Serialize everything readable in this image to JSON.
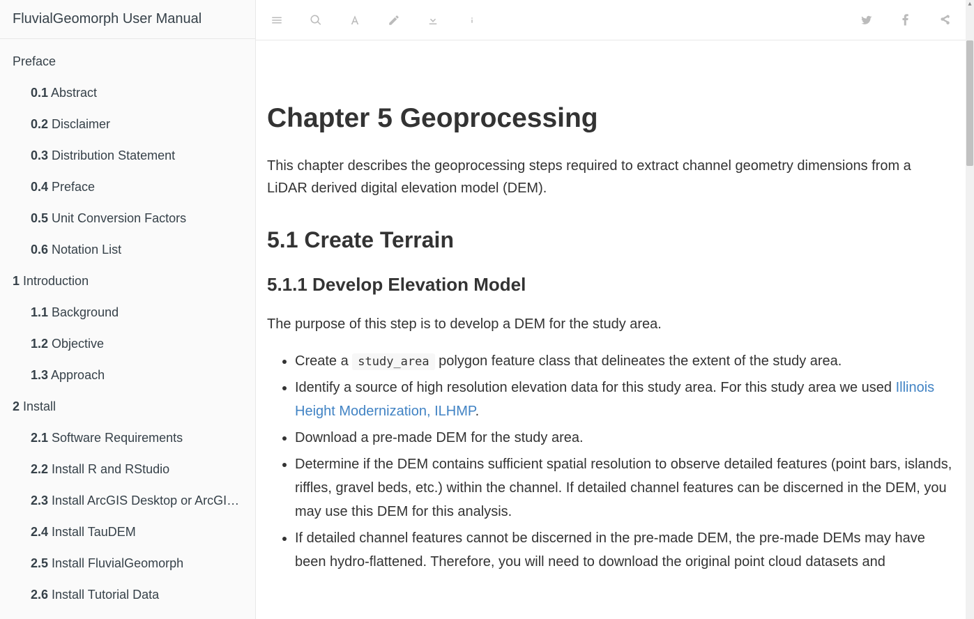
{
  "sidebar": {
    "title": "FluvialGeomorph User Manual",
    "items": [
      {
        "level": 1,
        "num": "",
        "label": "Preface"
      },
      {
        "level": 2,
        "num": "0.1",
        "label": "Abstract"
      },
      {
        "level": 2,
        "num": "0.2",
        "label": "Disclaimer"
      },
      {
        "level": 2,
        "num": "0.3",
        "label": "Distribution Statement"
      },
      {
        "level": 2,
        "num": "0.4",
        "label": "Preface"
      },
      {
        "level": 2,
        "num": "0.5",
        "label": "Unit Conversion Factors"
      },
      {
        "level": 2,
        "num": "0.6",
        "label": "Notation List"
      },
      {
        "level": 1,
        "num": "1",
        "label": "Introduction"
      },
      {
        "level": 2,
        "num": "1.1",
        "label": "Background"
      },
      {
        "level": 2,
        "num": "1.2",
        "label": "Objective"
      },
      {
        "level": 2,
        "num": "1.3",
        "label": "Approach"
      },
      {
        "level": 1,
        "num": "2",
        "label": "Install"
      },
      {
        "level": 2,
        "num": "2.1",
        "label": "Software Requirements"
      },
      {
        "level": 2,
        "num": "2.2",
        "label": "Install R and RStudio"
      },
      {
        "level": 2,
        "num": "2.3",
        "label": "Install ArcGIS Desktop or ArcGIS Pro"
      },
      {
        "level": 2,
        "num": "2.4",
        "label": "Install TauDEM"
      },
      {
        "level": 2,
        "num": "2.5",
        "label": "Install FluvialGeomorph"
      },
      {
        "level": 2,
        "num": "2.6",
        "label": "Install Tutorial Data"
      }
    ]
  },
  "content": {
    "h1": "Chapter 5   Geoprocessing",
    "p1": "This chapter describes the geoprocessing steps required to extract channel geometry dimensions from a LiDAR derived digital elevation model (DEM).",
    "h2": "5.1   Create Terrain",
    "h3": "5.1.1   Develop Elevation Model",
    "p2": "The purpose of this step is to develop a DEM for the study area.",
    "bullets": {
      "b1a": "Create a ",
      "b1code": "study_area",
      "b1b": " polygon feature class that delineates the extent of the study area.",
      "b2a": "Identify a source of high resolution elevation data for this study area. For this study area we used ",
      "b2link": "Illinois Height Modernization, ILHMP",
      "b2b": ".",
      "b3": "Download a pre-made DEM for the study area.",
      "b4": "Determine if the DEM contains sufficient spatial resolution to observe detailed features (point bars, islands, riffles, gravel beds, etc.) within the channel. If detailed channel features can be discerned in the DEM, you may use this DEM for this analysis.",
      "b5": "If detailed channel features cannot be discerned in the pre-made DEM, the pre-made DEMs may have been hydro-flattened. Therefore, you will need to download the original point cloud datasets and"
    }
  }
}
